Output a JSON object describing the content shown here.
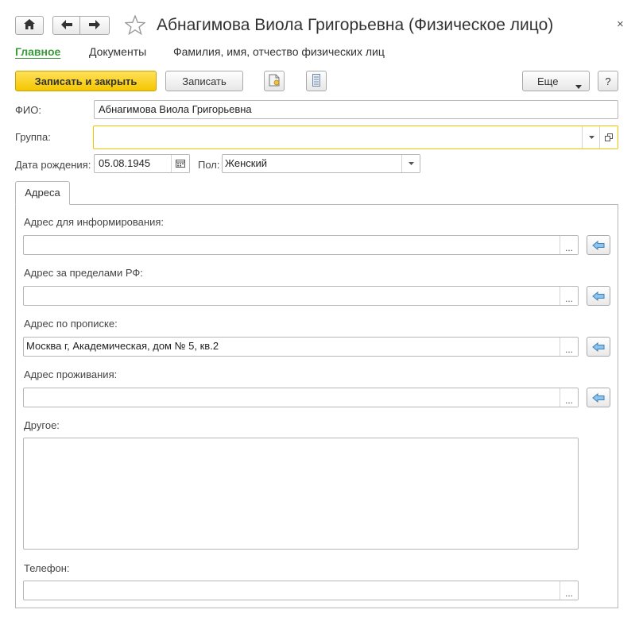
{
  "window": {
    "title": "Абнагимова Виола Григорьевна (Физическое лицо)",
    "close": "×"
  },
  "sections": [
    {
      "label": "Главное"
    },
    {
      "label": "Документы"
    },
    {
      "label": "Фамилия, имя, отчество физических лиц"
    }
  ],
  "toolbar": {
    "save_close_label": "Записать и закрыть",
    "save_label": "Записать",
    "more_label": "Еще",
    "help_label": "?"
  },
  "form": {
    "fio_label": "ФИО:",
    "fio_value": "Абнагимова Виола Григорьевна",
    "group_label": "Группа:",
    "group_value": "",
    "birth_label": "Дата рождения:",
    "birth_value": "05.08.1945",
    "sex_label": "Пол:",
    "sex_value": "Женский"
  },
  "tabs": [
    {
      "label": "Адреса"
    }
  ],
  "addresses": {
    "info_label": "Адрес для информирования:",
    "info_value": "",
    "abroad_label": "Адрес за пределами РФ:",
    "abroad_value": "",
    "registration_label": "Адрес по прописке:",
    "registration_value": "Москва г, Академическая, дом № 5, кв.2",
    "residence_label": "Адрес проживания:",
    "residence_value": "",
    "other_label": "Другое:",
    "phone_label": "Телефон:",
    "phone_value": ""
  },
  "colors": {
    "accent_green": "#3a9b3a",
    "primary_button": "#f5c600",
    "focus_border": "#f2c300"
  }
}
